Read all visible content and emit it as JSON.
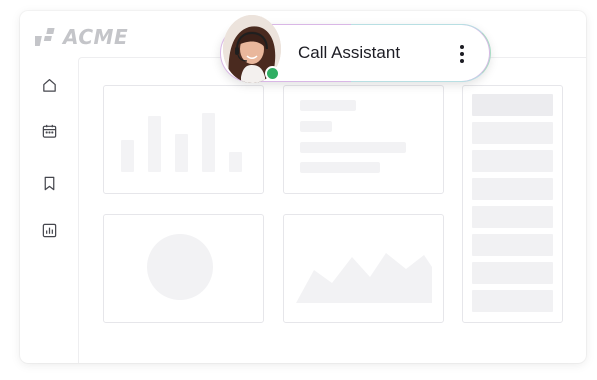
{
  "app": {
    "logo_text": "ACME"
  },
  "sidebar": {
    "items": [
      {
        "icon": "home-icon"
      },
      {
        "icon": "calendar-icon"
      },
      {
        "icon": "bookmark-icon"
      },
      {
        "icon": "bar-chart-icon"
      }
    ]
  },
  "assistant": {
    "title": "Call Assistant",
    "status": "online",
    "status_color": "#2fae63",
    "menu_icon": "kebab-menu-icon"
  },
  "colors": {
    "placeholder": "#f2f2f4",
    "logo": "#c4c5c9"
  }
}
